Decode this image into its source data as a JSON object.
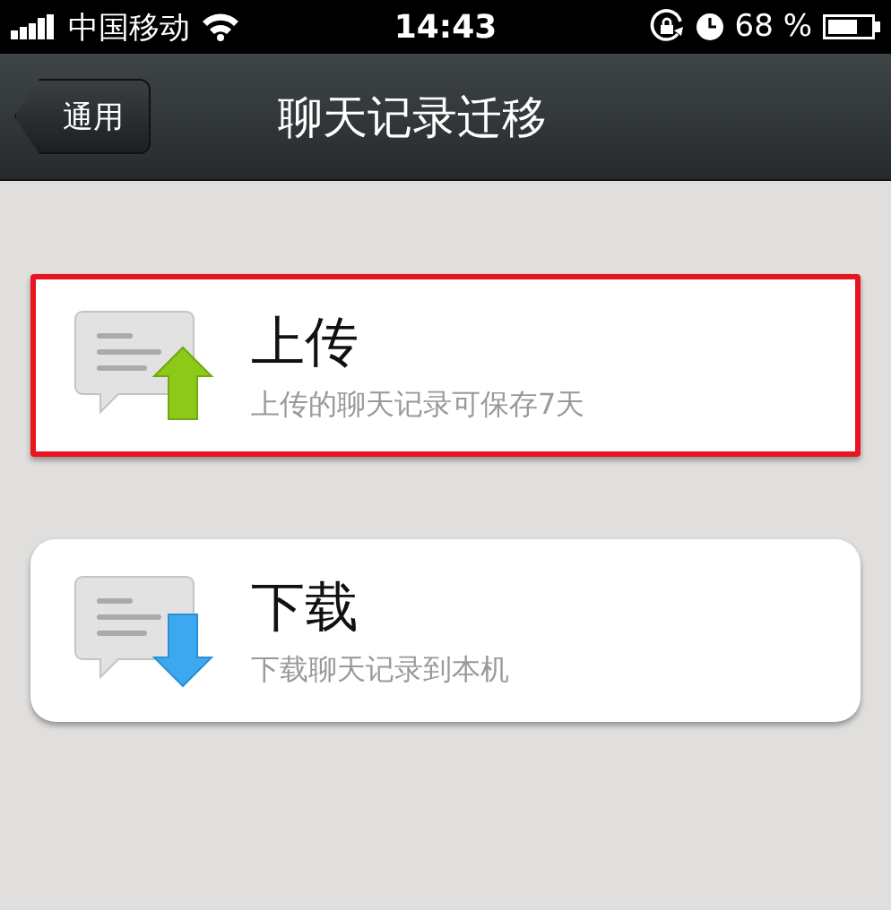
{
  "status_bar": {
    "carrier": "中国移动",
    "time": "14:43",
    "battery": "68 %"
  },
  "nav": {
    "back": "通用",
    "title": "聊天记录迁移"
  },
  "options": [
    {
      "kind": "upload",
      "title": "上传",
      "subtitle": "上传的聊天记录可保存7天",
      "selected": true
    },
    {
      "kind": "download",
      "title": "下载",
      "subtitle": "下载聊天记录到本机",
      "selected": false
    }
  ]
}
